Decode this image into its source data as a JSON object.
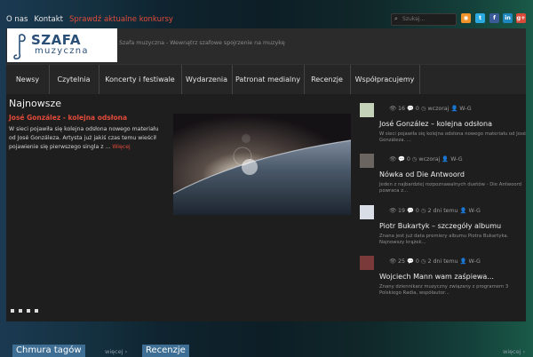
{
  "topnav": [
    "O nas",
    "Kontakt",
    "Sprawdź aktualne konkursy"
  ],
  "search": {
    "placeholder": "Szukaj..."
  },
  "social_icons": [
    {
      "name": "rss-icon",
      "glyph": "◉",
      "color": "#f0932b"
    },
    {
      "name": "twitter-icon",
      "glyph": "t",
      "color": "#2aa9e0"
    },
    {
      "name": "facebook-icon",
      "glyph": "f",
      "color": "#3b5b98"
    },
    {
      "name": "linkedin-icon",
      "glyph": "in",
      "color": "#1d87be"
    },
    {
      "name": "googleplus-icon",
      "glyph": "g+",
      "color": "#d94b38"
    }
  ],
  "logo": {
    "line1": "SZAFA",
    "line2": "muzyczna"
  },
  "tagline": "Szafa muzyczna - Wewnątrz szafowe spojrzenie na muzykę",
  "menu": [
    "Newsy",
    "Czytelnia",
    "Koncerty i festiwale",
    "Wydarzenia",
    "Patronat medialny",
    "Recenzje",
    "Współpracujemy"
  ],
  "section_title": "Najnowsze",
  "featured": {
    "title": "José González - kolejna odsłona",
    "text": "W sieci pojawiła się kolejna odsłona nowego materiału od José Gonzáleza. Artysta już jakiś czas temu wieścił pojawienie się pierwszego singla z ...",
    "more": "Więcej"
  },
  "side_items": [
    {
      "views": "16",
      "comments": "0",
      "date": "wczoraj",
      "author": "W-G",
      "title": "José González – kolejna odsłona",
      "excerpt": "W sieci pojawiła się kolejna odsłona nowego materiału od José Gonzáleza. ..."
    },
    {
      "views": "",
      "comments": "0",
      "date": "wczoraj",
      "author": "W-G",
      "title": "Nówka od Die Antwoord",
      "excerpt": "Jeden z najbardziej rozpoznawalnych duetów - Die Antwoord powraca z..."
    },
    {
      "views": "19",
      "comments": "0",
      "date": "2 dni temu",
      "author": "W-G",
      "title": "Piotr Bukartyk – szczegóły albumu",
      "excerpt": "Znana jest już data premiery albumu Piotra Bukartyka. Najnowszy krążek..."
    },
    {
      "views": "25",
      "comments": "0",
      "date": "2 dni temu",
      "author": "W-G",
      "title": "Wojciech Mann wam zaśpiewa...",
      "excerpt": "Znany dziennikarz muzyczny związany z programem 3 Polskiego Radia, współautor..."
    }
  ],
  "bottom": {
    "tag_cloud": "Chmura tagów",
    "more1": "więcej",
    "reviews": "Recenzje",
    "more2": "więcej"
  }
}
